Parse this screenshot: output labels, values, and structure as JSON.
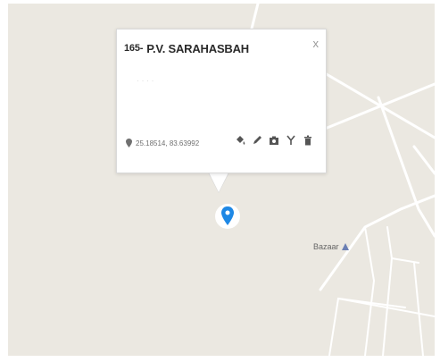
{
  "popup": {
    "number": "165-",
    "title": "P.V. SARAHASBAH",
    "subtitle": "· · · ·",
    "close_label": "x",
    "coordinates": "25.18514, 83.63992"
  },
  "tools": [
    "paint-bucket-icon",
    "pencil-icon",
    "camera-icon",
    "fork-icon",
    "trash-icon"
  ],
  "map": {
    "place_label": "Bazaar",
    "marker_color": "#1e88e5",
    "road_color": "#ffffff",
    "background_color": "#ebe8e1"
  }
}
